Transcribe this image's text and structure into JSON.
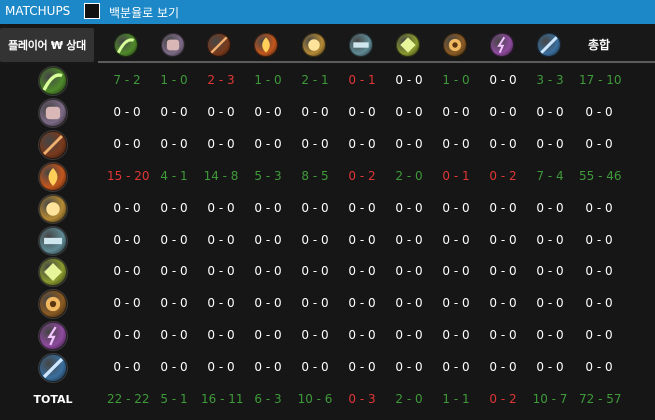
{
  "topbar": {
    "title": "MATCHUPS",
    "percent_toggle_label": "백분율로 보기",
    "percent_toggle_checked": false,
    "background": "#1c88c7"
  },
  "header": {
    "player_vs_label": "플레이어 ₩ 상대",
    "total_label": "총합"
  },
  "classes": [
    {
      "icon": "druid-claw-icon",
      "color": "#4f8a2a"
    },
    {
      "icon": "fist-icon",
      "color": "#7d6a86"
    },
    {
      "icon": "spear-icon",
      "color": "#7a3a1c"
    },
    {
      "icon": "fire-icon",
      "color": "#c2561c"
    },
    {
      "icon": "fist-glow-icon",
      "color": "#b58a35"
    },
    {
      "icon": "pistol-icon",
      "color": "#5f8a94"
    },
    {
      "icon": "leaf-claw-icon",
      "color": "#8a9a2e"
    },
    {
      "icon": "bear-icon",
      "color": "#8a5a22"
    },
    {
      "icon": "lightning-icon",
      "color": "#8e4a9e"
    },
    {
      "icon": "sword-icon",
      "color": "#3a6f9e"
    }
  ],
  "rows": [
    [
      "7 - 2",
      "1 - 0",
      "2 - 3",
      "1 - 0",
      "2 - 1",
      "0 - 1",
      "0 - 0",
      "1 - 0",
      "0 - 0",
      "3 - 3",
      "17 - 10"
    ],
    [
      "0 - 0",
      "0 - 0",
      "0 - 0",
      "0 - 0",
      "0 - 0",
      "0 - 0",
      "0 - 0",
      "0 - 0",
      "0 - 0",
      "0 - 0",
      "0 - 0"
    ],
    [
      "0 - 0",
      "0 - 0",
      "0 - 0",
      "0 - 0",
      "0 - 0",
      "0 - 0",
      "0 - 0",
      "0 - 0",
      "0 - 0",
      "0 - 0",
      "0 - 0"
    ],
    [
      "15 - 20",
      "4 - 1",
      "14 - 8",
      "5 - 3",
      "8 - 5",
      "0 - 2",
      "2 - 0",
      "0 - 1",
      "0 - 2",
      "7 - 4",
      "55 - 46"
    ],
    [
      "0 - 0",
      "0 - 0",
      "0 - 0",
      "0 - 0",
      "0 - 0",
      "0 - 0",
      "0 - 0",
      "0 - 0",
      "0 - 0",
      "0 - 0",
      "0 - 0"
    ],
    [
      "0 - 0",
      "0 - 0",
      "0 - 0",
      "0 - 0",
      "0 - 0",
      "0 - 0",
      "0 - 0",
      "0 - 0",
      "0 - 0",
      "0 - 0",
      "0 - 0"
    ],
    [
      "0 - 0",
      "0 - 0",
      "0 - 0",
      "0 - 0",
      "0 - 0",
      "0 - 0",
      "0 - 0",
      "0 - 0",
      "0 - 0",
      "0 - 0",
      "0 - 0"
    ],
    [
      "0 - 0",
      "0 - 0",
      "0 - 0",
      "0 - 0",
      "0 - 0",
      "0 - 0",
      "0 - 0",
      "0 - 0",
      "0 - 0",
      "0 - 0",
      "0 - 0"
    ],
    [
      "0 - 0",
      "0 - 0",
      "0 - 0",
      "0 - 0",
      "0 - 0",
      "0 - 0",
      "0 - 0",
      "0 - 0",
      "0 - 0",
      "0 - 0",
      "0 - 0"
    ],
    [
      "0 - 0",
      "0 - 0",
      "0 - 0",
      "0 - 0",
      "0 - 0",
      "0 - 0",
      "0 - 0",
      "0 - 0",
      "0 - 0",
      "0 - 0",
      "0 - 0"
    ]
  ],
  "totals": {
    "label": "TOTAL",
    "values": [
      "22 - 22",
      "5 - 1",
      "16 - 11",
      "6 - 3",
      "10 - 6",
      "0 - 3",
      "2 - 0",
      "1 - 1",
      "0 - 2",
      "10 - 7",
      "72 - 57"
    ]
  },
  "colors": {
    "win": "#3f9a3a",
    "loss": "#e03636",
    "even": "#ffffff",
    "background": "#161616"
  }
}
